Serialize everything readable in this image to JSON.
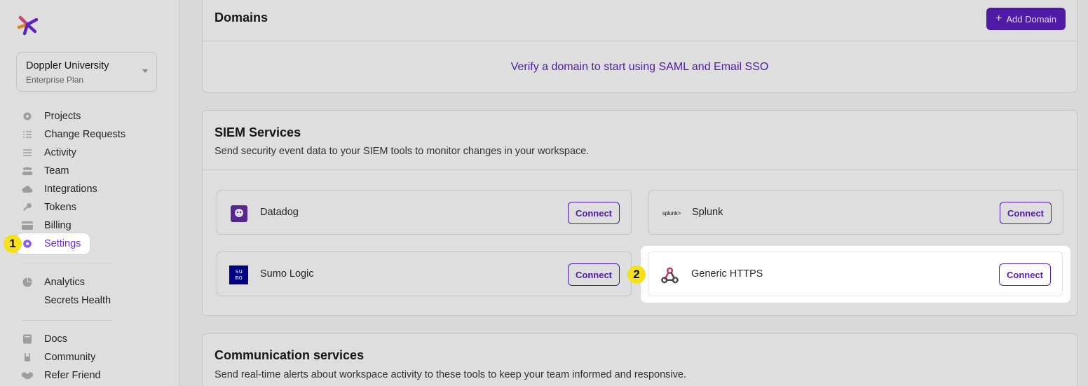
{
  "sidebar": {
    "workspace_name": "Doppler University",
    "workspace_plan": "Enterprise Plan",
    "items": [
      {
        "label": "Projects",
        "icon": "gear-cog-icon"
      },
      {
        "label": "Change Requests",
        "icon": "checklist-icon"
      },
      {
        "label": "Activity",
        "icon": "lines-icon"
      },
      {
        "label": "Team",
        "icon": "people-icon"
      },
      {
        "label": "Integrations",
        "icon": "cloud-icon"
      },
      {
        "label": "Tokens",
        "icon": "key-icon"
      },
      {
        "label": "Billing",
        "icon": "card-icon"
      },
      {
        "label": "Settings",
        "icon": "gear-icon"
      }
    ],
    "items2": [
      {
        "label": "Analytics",
        "icon": "pie-chart-icon"
      },
      {
        "label": "Secrets Health",
        "icon": ""
      }
    ],
    "items3": [
      {
        "label": "Docs",
        "icon": "book-icon"
      },
      {
        "label": "Community",
        "icon": "hand-icon"
      },
      {
        "label": "Refer Friend",
        "icon": "handshake-icon"
      }
    ]
  },
  "badges": {
    "one": "1",
    "two": "2"
  },
  "domains": {
    "title": "Domains",
    "add_button": "Add Domain",
    "empty_text": "Verify a domain to start using SAML and Email SSO"
  },
  "siem": {
    "title": "SIEM Services",
    "subtitle": "Send security event data to your SIEM tools to monitor changes in your workspace.",
    "services": [
      {
        "name": "Datadog",
        "action": "Connect"
      },
      {
        "name": "Splunk",
        "action": "Connect",
        "logo_text": "splunk>"
      },
      {
        "name": "Sumo Logic",
        "action": "Connect",
        "logo_text": "su mo"
      },
      {
        "name": "Generic HTTPS",
        "action": "Connect"
      }
    ]
  },
  "communication": {
    "title": "Communication services",
    "subtitle": "Send real-time alerts about workspace activity to these tools to keep your team informed and responsive."
  },
  "colors": {
    "accent": "#5b1fbf",
    "badge": "#f5e11a"
  }
}
